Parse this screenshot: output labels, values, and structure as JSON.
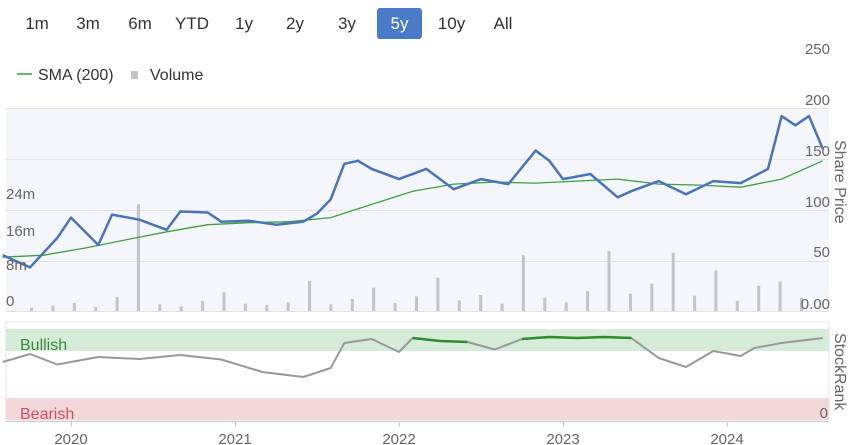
{
  "range_selector": {
    "buttons": [
      {
        "label": "1m",
        "active": false
      },
      {
        "label": "3m",
        "active": false
      },
      {
        "label": "6m",
        "active": false
      },
      {
        "label": "YTD",
        "active": false
      },
      {
        "label": "1y",
        "active": false
      },
      {
        "label": "2y",
        "active": false
      },
      {
        "label": "3y",
        "active": false
      },
      {
        "label": "5y",
        "active": true
      },
      {
        "label": "10y",
        "active": false
      },
      {
        "label": "All",
        "active": false
      }
    ]
  },
  "legend": {
    "sma_label": "SMA (200)",
    "volume_label": "Volume"
  },
  "colors": {
    "price": "#4a74b8",
    "sma": "#3fa03f",
    "volume": "#c4c4c8",
    "bullish_band": "#d5ecd8",
    "bearish_band": "#f3d8da",
    "bullish_text": "#3a8a3a",
    "bearish_text": "#d05060",
    "rank_line": "#999999",
    "rank_bull": "#2e8b2e",
    "rank_bear": "#d9534f",
    "active_button": "#4a7bc8"
  },
  "chart_data": [
    {
      "type": "line",
      "ylabel": "Share Price",
      "ylim": [
        0,
        250
      ],
      "right_ticks": [
        "250",
        "200",
        "150",
        "100",
        "50",
        "0.00"
      ],
      "left_ticks": [
        "24m",
        "16m",
        "8m",
        "0"
      ],
      "x_ticks": [
        "2020",
        "2021",
        "2022",
        "2023",
        "2024"
      ],
      "series": [
        {
          "name": "SMA (200)",
          "x": [
            "2019-08",
            "2019-11",
            "2020-02",
            "2020-05",
            "2020-08",
            "2020-11",
            "2021-02",
            "2021-05",
            "2021-08",
            "2021-11",
            "2022-02",
            "2022-05",
            "2022-08",
            "2022-11",
            "2023-02",
            "2023-05",
            "2023-08",
            "2023-11",
            "2024-02",
            "2024-05",
            "2024-08"
          ],
          "values": [
            53,
            55,
            62,
            70,
            78,
            85,
            87,
            88,
            92,
            105,
            118,
            125,
            127,
            126,
            128,
            130,
            125,
            124,
            122,
            130,
            148
          ]
        },
        {
          "name": "Price",
          "x": [
            "2019-08",
            "2019-10",
            "2019-12",
            "2020-01",
            "2020-03",
            "2020-04",
            "2020-06",
            "2020-08",
            "2020-09",
            "2020-11",
            "2020-12",
            "2021-02",
            "2021-04",
            "2021-06",
            "2021-07",
            "2021-08",
            "2021-09",
            "2021-10",
            "2021-11",
            "2022-01",
            "2022-03",
            "2022-05",
            "2022-07",
            "2022-09",
            "2022-11",
            "2022-12",
            "2023-01",
            "2023-03",
            "2023-05",
            "2023-06",
            "2023-08",
            "2023-10",
            "2023-12",
            "2024-02",
            "2024-04",
            "2024-05",
            "2024-06",
            "2024-07",
            "2024-08"
          ],
          "values": [
            55,
            43,
            72,
            92,
            65,
            95,
            90,
            80,
            98,
            97,
            88,
            89,
            85,
            88,
            96,
            110,
            145,
            148,
            140,
            130,
            140,
            120,
            130,
            125,
            158,
            148,
            130,
            135,
            112,
            118,
            128,
            115,
            128,
            126,
            140,
            192,
            183,
            192,
            160
          ]
        }
      ]
    },
    {
      "type": "bar",
      "title": "Volume",
      "note": "volume bars shown as relative heights, left axis in millions",
      "values": [
        0.5,
        0.8,
        1.2,
        0.6,
        2.1,
        16.0,
        1.0,
        0.7,
        1.5,
        2.8,
        1.1,
        0.9,
        1.3,
        4.5,
        1.0,
        1.8,
        3.5,
        1.2,
        2.2,
        5.0,
        1.6,
        2.4,
        1.1,
        8.4,
        2.0,
        1.3,
        3.0,
        9.0,
        2.6,
        4.1,
        8.7,
        2.3,
        6.1,
        1.5,
        3.8,
        4.4,
        2.0
      ]
    },
    {
      "type": "line",
      "ylabel": "StockRank",
      "right_ticks": [
        "0"
      ],
      "bands": {
        "top": "Bullish",
        "bottom": "Bearish"
      },
      "series": [
        {
          "name": "StockRank",
          "x": [
            "2019-08",
            "2019-10",
            "2019-12",
            "2020-03",
            "2020-06",
            "2020-09",
            "2020-12",
            "2021-03",
            "2021-06",
            "2021-08",
            "2021-09",
            "2021-11",
            "2022-01",
            "2022-02",
            "2022-04",
            "2022-06",
            "2022-08",
            "2022-10",
            "2022-12",
            "2023-02",
            "2023-04",
            "2023-06",
            "2023-08",
            "2023-10",
            "2023-12",
            "2024-02",
            "2024-03",
            "2024-05",
            "2024-08"
          ],
          "values": [
            50,
            66,
            45,
            60,
            56,
            64,
            55,
            30,
            20,
            38,
            88,
            96,
            70,
            98,
            92,
            90,
            75,
            96,
            100,
            98,
            100,
            98,
            58,
            40,
            72,
            62,
            78,
            88,
            98
          ]
        }
      ]
    }
  ]
}
